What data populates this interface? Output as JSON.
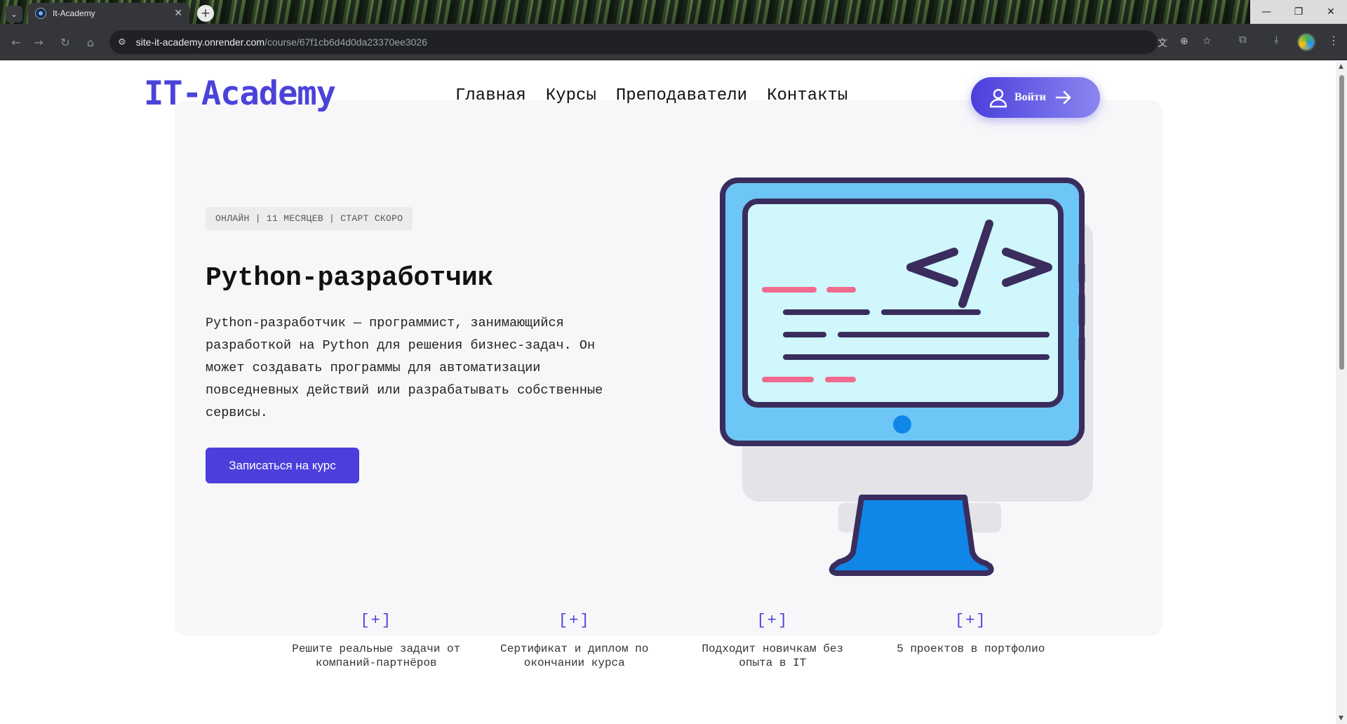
{
  "browser": {
    "tab_title": "It-Academy",
    "url_host": "site-it-academy.onrender.com",
    "url_path": "/course/67f1cb6d4d0da23370ee3026"
  },
  "header": {
    "logo": "IT-Academy",
    "nav": [
      "Главная",
      "Курсы",
      "Преподаватели",
      "Контакты"
    ],
    "login_label": "Войти"
  },
  "course": {
    "meta": "ОНЛАЙН | 11 МЕСЯЦЕВ | СТАРТ СКОРО",
    "title": "Python-разработчик",
    "description": "Python-разработчик — программист, занимающийся разработкой на Python для решения бизнес-задач. Он может создавать программы для автоматизации повседневных действий или разрабатывать собственные сервисы.",
    "enroll_label": "Записаться на курс",
    "illustration_icon": "computer-code-icon"
  },
  "features": [
    {
      "marker": "[+]",
      "text": "Решите реальные задачи от компаний-партнёров"
    },
    {
      "marker": "[+]",
      "text": "Сертификат и диплом по окончании курса"
    },
    {
      "marker": "[+]",
      "text": "Подходит новичкам без опыта в IT"
    },
    {
      "marker": "[+]",
      "text": "5 проектов в портфолио"
    }
  ],
  "colors": {
    "accent": "#4b43d9",
    "hero_bg": "#f7f7f9"
  }
}
